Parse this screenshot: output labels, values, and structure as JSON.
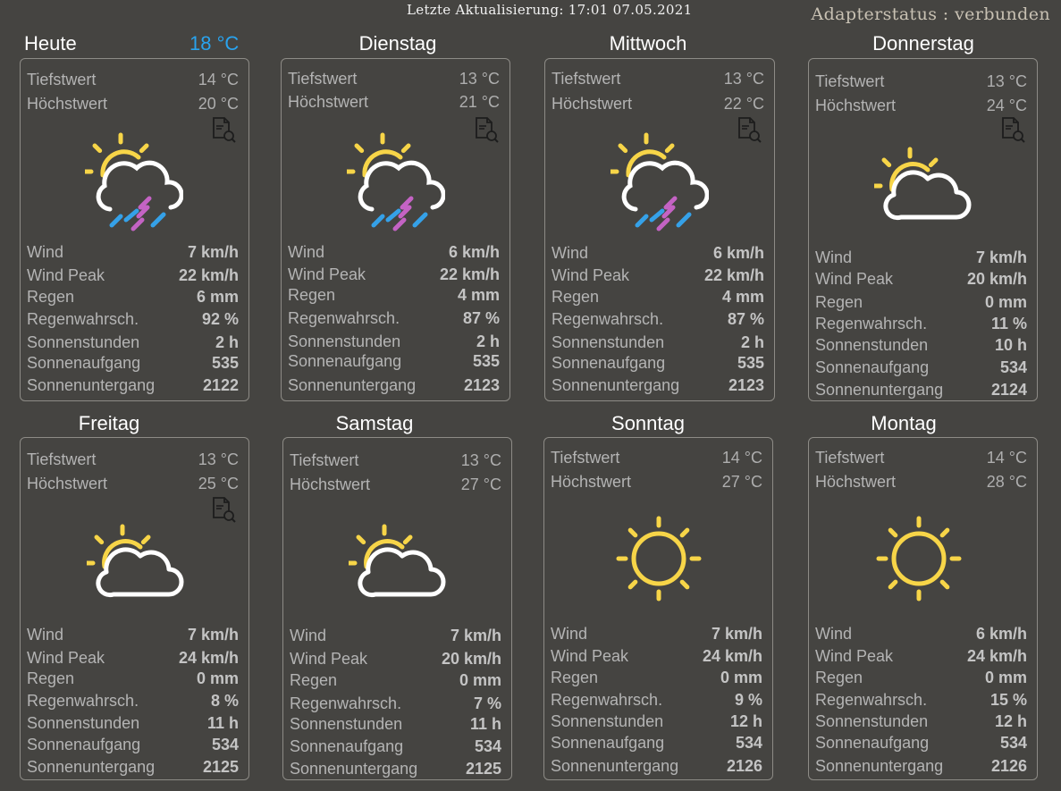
{
  "header": {
    "last_update": "Letzte Aktualisierung: 17:01 07.05.2021",
    "adapter_status": "Adapterstatus : verbunden"
  },
  "today": {
    "title": "Heute",
    "current_temp": "18 °C"
  },
  "colors": {
    "background": "#454441",
    "card_border": "#8d8b86",
    "sun": "#f7d548",
    "cloud": "#ffffff",
    "rain_blue": "#35a1e8",
    "rain_purple": "#c463c4",
    "current_temp": "#29a3ee"
  },
  "labels": {
    "low": "Tiefstwert",
    "high": "Höchstwert",
    "wind": "Wind",
    "wind_peak": "Wind Peak",
    "rain": "Regen",
    "rain_prob": "Regenwahrsch.",
    "sun_hours": "Sonnenstunden",
    "sunrise": "Sonnenaufgang",
    "sunset": "Sonnenuntergang"
  },
  "days": [
    {
      "name": "Heute",
      "low": "14 °C",
      "high": "20 °C",
      "wind": "7 km/h",
      "wind_peak": "22 km/h",
      "rain": "6 mm",
      "rain_prob": "92 %",
      "sun_hours": "2 h",
      "sunrise": "535",
      "sunset": "2122",
      "icon": "partly-cloudy-rain-icon",
      "doc_icon": true
    },
    {
      "name": "Dienstag",
      "low": "13 °C",
      "high": "21 °C",
      "wind": "6 km/h",
      "wind_peak": "22 km/h",
      "rain": "4 mm",
      "rain_prob": "87 %",
      "sun_hours": "2 h",
      "sunrise": "535",
      "sunset": "2123",
      "icon": "partly-cloudy-rain-icon",
      "doc_icon": true
    },
    {
      "name": "Mittwoch",
      "low": "13 °C",
      "high": "22 °C",
      "wind": "6 km/h",
      "wind_peak": "22 km/h",
      "rain": "4 mm",
      "rain_prob": "87 %",
      "sun_hours": "2 h",
      "sunrise": "535",
      "sunset": "2123",
      "icon": "partly-cloudy-rain-icon",
      "doc_icon": true
    },
    {
      "name": "Donnerstag",
      "low": "13 °C",
      "high": "24 °C",
      "wind": "7 km/h",
      "wind_peak": "20 km/h",
      "rain": "0 mm",
      "rain_prob": "11 %",
      "sun_hours": "10 h",
      "sunrise": "534",
      "sunset": "2124",
      "icon": "partly-cloudy-icon",
      "doc_icon": true
    },
    {
      "name": "Freitag",
      "low": "13 °C",
      "high": "25 °C",
      "wind": "7 km/h",
      "wind_peak": "24 km/h",
      "rain": "0 mm",
      "rain_prob": "8 %",
      "sun_hours": "11 h",
      "sunrise": "534",
      "sunset": "2125",
      "icon": "partly-cloudy-icon",
      "doc_icon": true
    },
    {
      "name": "Samstag",
      "low": "13 °C",
      "high": "27 °C",
      "wind": "7 km/h",
      "wind_peak": "20 km/h",
      "rain": "0 mm",
      "rain_prob": "7 %",
      "sun_hours": "11 h",
      "sunrise": "534",
      "sunset": "2125",
      "icon": "partly-cloudy-icon",
      "doc_icon": false
    },
    {
      "name": "Sonntag",
      "low": "14 °C",
      "high": "27 °C",
      "wind": "7 km/h",
      "wind_peak": "24 km/h",
      "rain": "0 mm",
      "rain_prob": "9 %",
      "sun_hours": "12 h",
      "sunrise": "534",
      "sunset": "2126",
      "icon": "sun-icon",
      "doc_icon": false
    },
    {
      "name": "Montag",
      "low": "14 °C",
      "high": "28 °C",
      "wind": "6 km/h",
      "wind_peak": "24 km/h",
      "rain": "0 mm",
      "rain_prob": "15 %",
      "sun_hours": "12 h",
      "sunrise": "534",
      "sunset": "2126",
      "icon": "sun-icon",
      "doc_icon": false
    }
  ]
}
